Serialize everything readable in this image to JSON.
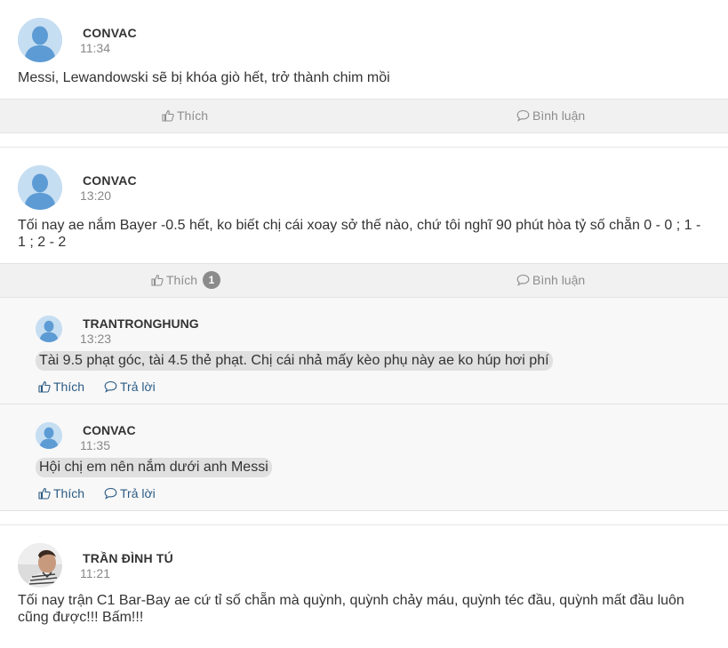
{
  "posts": [
    {
      "author": "CONVAC",
      "time": "11:34",
      "content": "Messi, Lewandowski sẽ bị khóa giò hết, trở thành chim mồi",
      "like_label": "Thích",
      "comment_label": "Bình luận"
    },
    {
      "author": "CONVAC",
      "time": "13:20",
      "content": "Tối nay ae nắm Bayer -0.5 hết, ko biết chị cái xoay sở thế nào, chứ tôi nghĩ 90 phút hòa tỷ số chẵn 0 - 0 ; 1 - 1 ; 2 - 2",
      "like_label": "Thích",
      "like_count": "1",
      "comment_label": "Bình luận",
      "replies": [
        {
          "author": "TRANTRONGHUNG",
          "time": "13:23",
          "content": "Tài 9.5 phạt góc, tài 4.5 thẻ phạt. Chị cái nhả mấy kèo phụ này ae ko húp hơi phí",
          "like_label": "Thích",
          "reply_label": "Trả lời"
        },
        {
          "author": "CONVAC",
          "time": "11:35",
          "content": "Hội chị em nên nắm dưới anh Messi",
          "like_label": "Thích",
          "reply_label": "Trả lời"
        }
      ]
    },
    {
      "author": "TRẦN ĐÌNH TÚ",
      "time": "11:21",
      "content": "Tối nay trận C1 Bar-Bay ae cứ tỉ số chẵn mà quỳnh, quỳnh chảy máu, quỳnh téc đầu, quỳnh mất đầu luôn cũng được!!! Bấm!!!"
    }
  ],
  "icons": {
    "like": "thumbs-up-icon",
    "comment": "speech-bubble-icon",
    "avatar_default": "user-silhouette-icon"
  },
  "colors": {
    "action_bar_bg": "#f1f1f1",
    "reply_bg": "#f8f8f8",
    "reply_link": "#2b5b84",
    "avatar_bg": "#c6def2",
    "avatar_figure": "#5d9bd4"
  }
}
